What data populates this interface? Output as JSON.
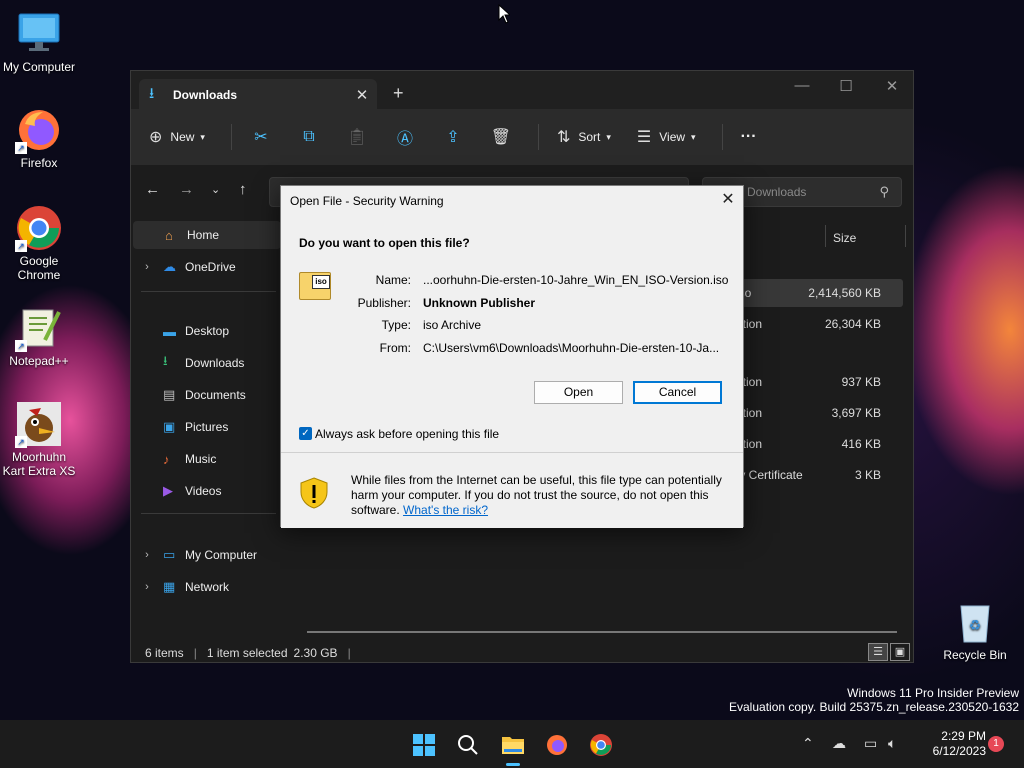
{
  "desktop": {
    "icons": [
      {
        "label": "My Computer"
      },
      {
        "label": "Firefox"
      },
      {
        "label": "Google Chrome"
      },
      {
        "label": "Notepad++"
      },
      {
        "label": "Moorhuhn Kart Extra XS"
      }
    ],
    "recycle_bin": {
      "label": "Recycle Bin"
    }
  },
  "explorer": {
    "tab_title": "Downloads",
    "toolbar": {
      "new_label": "New",
      "sort_label": "Sort",
      "view_label": "View",
      "more_label": "···"
    },
    "search_placeholder": "Downloads",
    "sidebar": {
      "items": [
        {
          "label": "Home"
        },
        {
          "label": "OneDrive"
        },
        {
          "label": "Desktop"
        },
        {
          "label": "Downloads"
        },
        {
          "label": "Documents"
        },
        {
          "label": "Pictures"
        },
        {
          "label": "Music"
        },
        {
          "label": "Videos"
        },
        {
          "label": "My Computer"
        },
        {
          "label": "Network"
        }
      ]
    },
    "columns": {
      "size": "Size"
    },
    "rows": [
      {
        "type": "iso",
        "size": "2,414,560 KB"
      },
      {
        "type": "ation",
        "size": "26,304 KB"
      },
      {
        "type": "ation",
        "size": "937 KB"
      },
      {
        "type": "ation",
        "size": "3,697 KB"
      },
      {
        "type": "ation",
        "size": "416 KB"
      },
      {
        "type": "ty Certificate",
        "size": "3 KB"
      }
    ],
    "status": {
      "items": "6 items",
      "selected": "1 item selected",
      "selected_size": "2.30 GB"
    }
  },
  "dialog": {
    "title": "Open File - Security Warning",
    "question": "Do you want to open this file?",
    "file_icon_label": "iso",
    "fields": {
      "name_key": "Name:",
      "name_val": "...oorhuhn-Die-ersten-10-Jahre_Win_EN_ISO-Version.iso",
      "publisher_key": "Publisher:",
      "publisher_val": "Unknown Publisher",
      "type_key": "Type:",
      "type_val": "iso Archive",
      "from_key": "From:",
      "from_val": "C:\\Users\\vm6\\Downloads\\Moorhuhn-Die-ersten-10-Ja..."
    },
    "open_label": "Open",
    "cancel_label": "Cancel",
    "checkbox_label": "Always ask before opening this file",
    "warning_text": "While files from the Internet can be useful, this file type can potentially harm your computer. If you do not trust the source, do not open this software. ",
    "warning_link": "What's the risk?"
  },
  "watermark": {
    "line1": "Windows 11 Pro Insider Preview",
    "line2": "Evaluation copy. Build 25375.zn_release.230520-1632"
  },
  "taskbar": {
    "time": "2:29 PM",
    "date": "6/12/2023",
    "notification_count": "1"
  }
}
